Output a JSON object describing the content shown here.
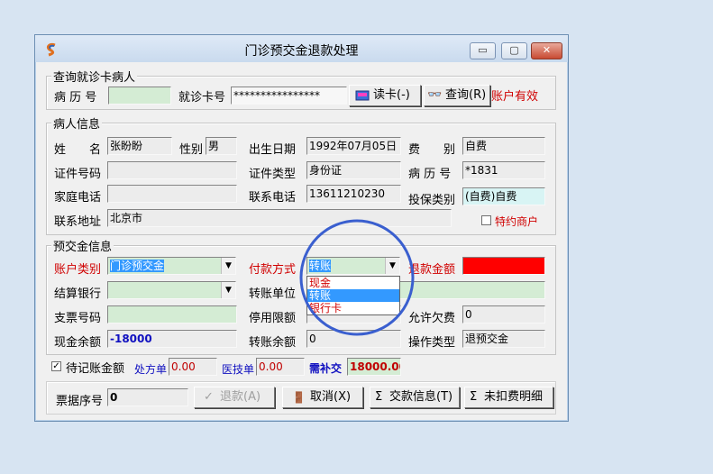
{
  "window": {
    "title": "门诊预交金退款处理",
    "controls": {
      "minimize": "▭",
      "maximize": "▢",
      "close": "✕"
    }
  },
  "query_group": {
    "label": "查询就诊卡病人",
    "record_no_label": "病 历 号",
    "record_no_value": "",
    "card_no_label": "就诊卡号",
    "card_no_value": "****************",
    "read_card_button": "读卡(-)",
    "query_button": "查询(R)",
    "account_status": "账户有效"
  },
  "patient_group": {
    "label": "病人信息",
    "name_label": "姓　　名",
    "name_value": "张盼盼",
    "gender_label": "性别",
    "gender_value": "男",
    "birth_label": "出生日期",
    "birth_value": "1992年07月05日",
    "fee_type_label": "费　　别",
    "fee_type_value": "自费",
    "id_no_label": "证件号码",
    "id_no_value": "",
    "id_type_label": "证件类型",
    "id_type_value": "身份证",
    "record_label": "病 历 号",
    "record_value": "*1831",
    "home_phone_label": "家庭电话",
    "home_phone_value": "",
    "contact_phone_label": "联系电话",
    "contact_phone_value": "13611210230",
    "insurance_label": "投保类别",
    "insurance_value": "(自费)自费",
    "address_label": "联系地址",
    "address_value": "北京市",
    "special_merchant_label": "特约商户",
    "special_merchant_checked": false
  },
  "deposit_group": {
    "label": "预交金信息",
    "account_type_label": "账户类别",
    "account_type_value": "门诊预交金",
    "payment_label": "付款方式",
    "payment_value": "转账",
    "refund_label": "退款金额",
    "refund_value": "",
    "bank_label": "结算银行",
    "bank_value": "",
    "transfer_unit_label": "转账单位",
    "transfer_unit_value": "",
    "check_no_label": "支票号码",
    "check_no_value": "",
    "stop_limit_label": "停用限额",
    "stop_limit_value": "",
    "allow_owe_label": "允许欠费",
    "allow_owe_value": "0",
    "cash_balance_label": "现金余额",
    "cash_balance_value": "-18000",
    "transfer_balance_label": "转账余额",
    "transfer_balance_value": "0",
    "op_type_label": "操作类型",
    "op_type_value": "退预交金",
    "payment_options": [
      "现金",
      "转账",
      "银行卡"
    ],
    "payment_selected_index": 1
  },
  "pending": {
    "checkbox_label": "待记账金额",
    "checked": true,
    "prescription_label": "处方单",
    "prescription_value": "0.00",
    "medtech_label": "医技单",
    "medtech_value": "0.00",
    "need_pay_label": "需补交",
    "need_pay_value": "18000.00"
  },
  "footer": {
    "receipt_label": "票据序号",
    "receipt_value": "0",
    "refund_button": "退款(A)",
    "cancel_button": "取消(X)",
    "payment_info_button": "交款信息(T)",
    "unpaid_detail_button": "未扣费明细"
  }
}
